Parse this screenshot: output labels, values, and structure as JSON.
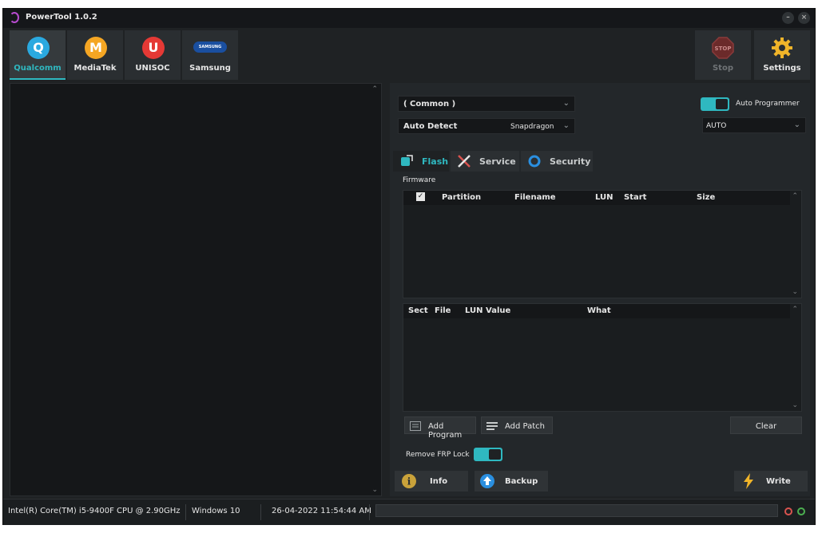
{
  "window": {
    "title": "PowerTool 1.0.2"
  },
  "vendors": [
    {
      "label": "Qualcomm",
      "glyph": "Q",
      "color": "#2aa9e0"
    },
    {
      "label": "MediaTek",
      "glyph": "M",
      "color": "#f5a623"
    },
    {
      "label": "UNISOC",
      "glyph": "U",
      "color": "#e53935"
    },
    {
      "label": "Samsung",
      "glyph": "SAMSUNG",
      "color": "#1a4fa0"
    }
  ],
  "toolbar": {
    "stop_label": "Stop",
    "settings_label": "Settings",
    "stop_sign": "STOP"
  },
  "config": {
    "loader_value": "( Common )",
    "auto_detect_label": "Auto Detect",
    "chipset_value": "Snapdragon",
    "auto_programmer_label": "Auto Programmer",
    "programmer_value": "AUTO"
  },
  "tabs": [
    {
      "label": "Flash"
    },
    {
      "label": "Service"
    },
    {
      "label": "Security"
    }
  ],
  "firmware": {
    "group_label": "Firmware",
    "columns": [
      "Partition",
      "Filename",
      "LUN",
      "Start",
      "Size"
    ],
    "patch_columns": [
      "Sect",
      "File",
      "LUN",
      "Value",
      "What"
    ]
  },
  "actions": {
    "add_program": "Add Program",
    "add_patch": "Add Patch",
    "clear": "Clear",
    "remove_frp": "Remove FRP Lock",
    "info": "Info",
    "backup": "Backup",
    "write": "Write"
  },
  "status": {
    "cpu": "Intel(R) Core(TM) i5-9400F CPU @ 2.90GHz",
    "os": "Windows 10",
    "datetime": "26-04-2022 11:54:44 AM"
  },
  "colors": {
    "accent": "#2fb8c0"
  }
}
